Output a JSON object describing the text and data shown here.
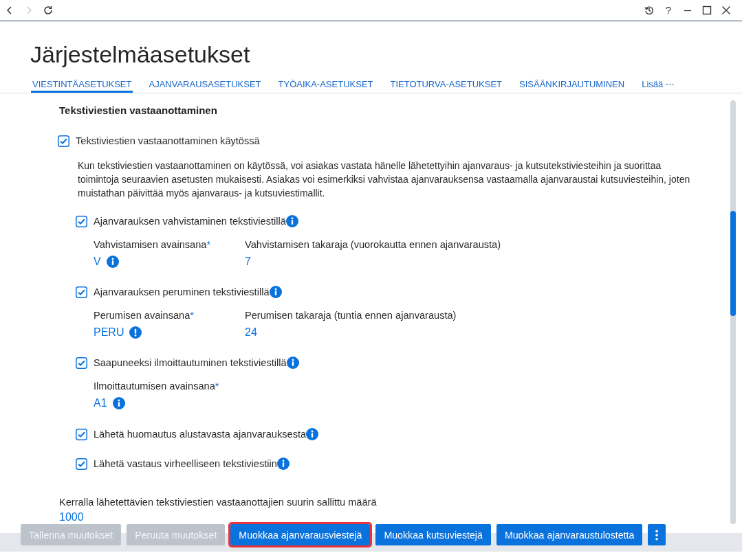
{
  "toolbar": {
    "nav": [
      {
        "kind": "back",
        "disabled": false
      },
      {
        "kind": "forward",
        "disabled": true
      },
      {
        "kind": "refresh",
        "disabled": false
      }
    ],
    "window_controls": [
      {
        "kind": "history"
      },
      {
        "kind": "help",
        "label": "?"
      },
      {
        "kind": "minimize"
      },
      {
        "kind": "maximize"
      },
      {
        "kind": "close"
      }
    ]
  },
  "page": {
    "title": "Järjestelmäasetukset"
  },
  "tabs": [
    {
      "label": "VIESTINTÄASETUKSET",
      "selected": true
    },
    {
      "label": "AJANVARAUSASETUKSET",
      "selected": false
    },
    {
      "label": "TYÖAIKA-ASETUKSET",
      "selected": false
    },
    {
      "label": "TIETOTURVA-ASETUKSET",
      "selected": false
    },
    {
      "label": "SISÄÄNKIRJAUTUMINEN",
      "selected": false
    }
  ],
  "more_menu": {
    "label": "Lisää ⋯"
  },
  "section": {
    "title": "Tekstiviestien vastaanottaminen",
    "main_option": {
      "label": "Tekstiviestien vastaanottaminen käytössä",
      "checked": true
    },
    "description": "Kun tekstiviestien vastaanottaminen on käytössä, voi asiakas vastata hänelle lähetettyihin ajanvaraus- ja kutsutekstiviesteihin ja suorittaa toimintoja seuraavien asetusten mukaisesti. Asiakas voi esimerkiksi vahvistaa ajanvarauksensa vastaamalla ajanvaraustai kutsuviesteihin, joten muistathan päivittää myös ajanvaraus- ja kutsuviestimallit.",
    "options": [
      {
        "label": "Ajanvarauksen vahvistaminen tekstiviestillä",
        "checked": true,
        "label_icon": {
          "kind": "info"
        },
        "fields": [
          {
            "label": "Vahvistamisen avainsana",
            "required_mark": "*",
            "value": "V",
            "value_icon": {
              "kind": "info"
            }
          },
          {
            "label": "Vahvistamisen takaraja (vuorokautta ennen ajanvarausta)",
            "value": "7"
          }
        ]
      },
      {
        "label": "Ajanvarauksen peruminen tekstiviestillä",
        "checked": true,
        "label_icon": {
          "kind": "info"
        },
        "fields": [
          {
            "label": "Perumisen avainsana",
            "required_mark": "*",
            "value": "PERU",
            "value_icon": {
              "kind": "alert"
            }
          },
          {
            "label": "Perumisen takaraja (tuntia ennen ajanvarausta)",
            "value": "24"
          }
        ]
      },
      {
        "label": "Saapuneeksi ilmoittautuminen tekstiviestillä",
        "checked": true,
        "label_icon": {
          "kind": "info"
        },
        "fields": [
          {
            "label": "Ilmoittautumisen avainsana",
            "required_mark": "*",
            "value": "A1",
            "value_icon": {
              "kind": "info"
            }
          }
        ]
      },
      {
        "label": "Lähetä huomautus alustavasta ajanvarauksesta",
        "checked": true,
        "label_icon": {
          "kind": "info"
        }
      },
      {
        "label": "Lähetä vastaus virheelliseen tekstiviestiin",
        "checked": true,
        "label_icon": {
          "kind": "info"
        }
      }
    ],
    "limit_field": {
      "label": "Kerralla lähetettävien tekstiviestien vastaanottajien suurin sallittu määrä",
      "value": "1000"
    }
  },
  "footer": {
    "buttons": [
      {
        "kind": "text",
        "label": "Tallenna muutokset",
        "disabled": true,
        "highlighted": false
      },
      {
        "kind": "text",
        "label": "Peruuta muutokset",
        "disabled": true,
        "highlighted": false
      },
      {
        "kind": "text",
        "label": "Muokkaa ajanvarausviestejä",
        "disabled": false,
        "highlighted": true
      },
      {
        "kind": "text",
        "label": "Muokkaa kutsuviestejä",
        "disabled": false,
        "highlighted": false
      },
      {
        "kind": "text",
        "label": "Muokkaa ajanvaraustulostetta",
        "disabled": false,
        "highlighted": false
      },
      {
        "kind": "menu",
        "disabled": false,
        "highlighted": false
      }
    ]
  }
}
